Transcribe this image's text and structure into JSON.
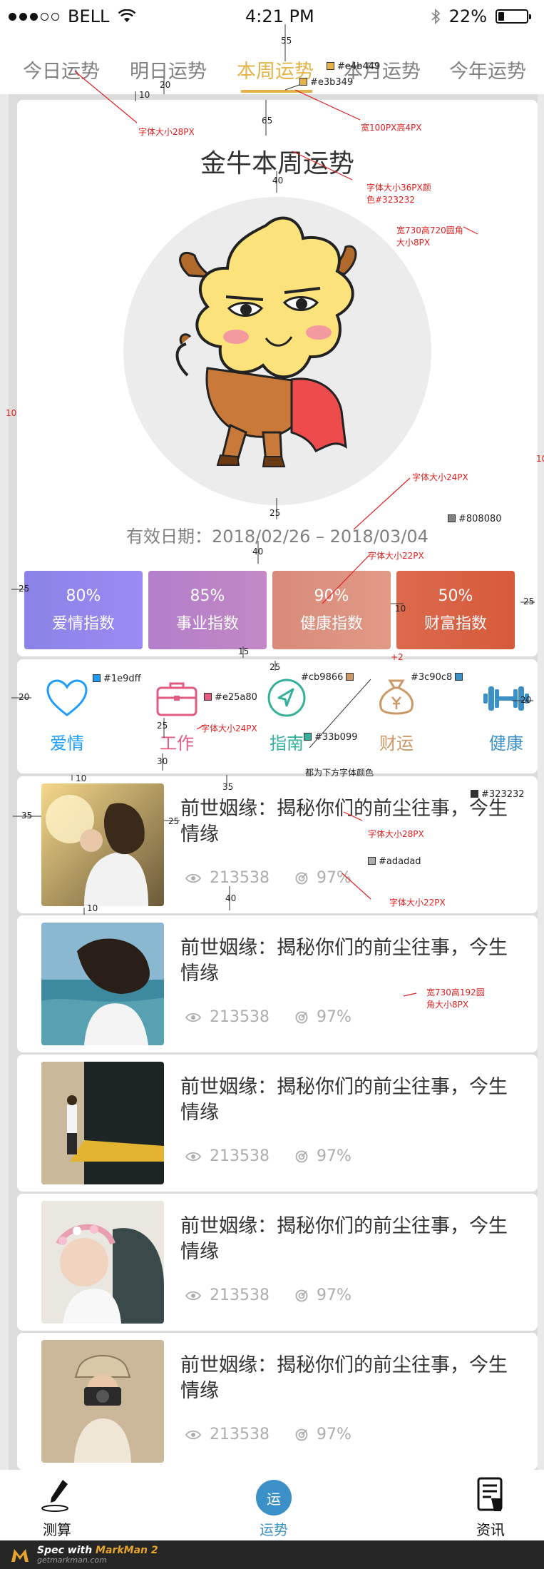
{
  "status_bar": {
    "carrier": "BELL",
    "time": "4:21 PM",
    "battery": "22%",
    "battery_level": 0.22
  },
  "tabs": [
    {
      "label": "今日运势"
    },
    {
      "label": "明日运势"
    },
    {
      "label": "本周运势",
      "active": true
    },
    {
      "label": "本月运势"
    },
    {
      "label": "今年运势"
    }
  ],
  "fortune": {
    "title": "金牛本周运势",
    "validity": "有效日期：2018/02/26 – 2018/03/04",
    "indices": [
      {
        "value": "80%",
        "label": "爱情指数"
      },
      {
        "value": "85%",
        "label": "事业指数"
      },
      {
        "value": "90%",
        "label": "健康指数"
      },
      {
        "value": "50%",
        "label": "财富指数"
      }
    ]
  },
  "categories": [
    {
      "label": "爱情",
      "icon": "heart-icon",
      "color": "#1e9dff"
    },
    {
      "label": "工作",
      "icon": "briefcase-icon",
      "color": "#e25a80"
    },
    {
      "label": "指南",
      "icon": "compass-icon",
      "color": "#33b099"
    },
    {
      "label": "财运",
      "icon": "money-bag-icon",
      "color": "#cb9866"
    },
    {
      "label": "健康",
      "icon": "dumbbell-icon",
      "color": "#3c90c8"
    }
  ],
  "articles": [
    {
      "title": "前世姻缘：揭秘你们的前尘往事，今生情缘",
      "views": "213538",
      "rate": "97%"
    },
    {
      "title": "前世姻缘：揭秘你们的前尘往事，今生情缘",
      "views": "213538",
      "rate": "97%"
    },
    {
      "title": "前世姻缘：揭秘你们的前尘往事，今生情缘",
      "views": "213538",
      "rate": "97%"
    },
    {
      "title": "前世姻缘：揭秘你们的前尘往事，今生情缘",
      "views": "213538",
      "rate": "97%"
    },
    {
      "title": "前世姻缘：揭秘你们的前尘往事，今生情缘",
      "views": "213538",
      "rate": "97%"
    }
  ],
  "bottom_nav": {
    "items": [
      {
        "label": "测算",
        "icon": "pen-icon"
      },
      {
        "label": "运势",
        "icon_text": "运",
        "active": true
      },
      {
        "label": "资讯",
        "icon": "news-icon"
      }
    ]
  },
  "branding": {
    "prefix": "Spec with ",
    "product": "MarkMan 2",
    "url": "getmarkman.com"
  },
  "annotations": {
    "tab_font": "字体大小28PX",
    "underline_size": "宽100PX高4PX",
    "title_font": "字体大小36PX颜色#323232",
    "card_size": "宽730高720圆角大小8PX",
    "date_font": "字体大小24PX",
    "index_font": "字体大小22PX",
    "cat_font": "字体大小24PX",
    "cat_note": "都为下方字体颜色",
    "art_title_font": "字体大小28PX",
    "art_meta_font": "字体大小22PX",
    "art_card_size": "宽730高192圆角大小8PX",
    "colors": {
      "tab_active": "#e4b449",
      "underline": "#e3b349",
      "date": "#808080",
      "art_title": "#323232",
      "art_meta": "#adadad",
      "love": "#1e9dff",
      "work": "#e25a80",
      "guide": "#33b099",
      "wealth": "#cb9866",
      "health": "#3c90c8"
    },
    "dims": [
      "55",
      "20",
      "10",
      "65",
      "40",
      "25",
      "40",
      "25",
      "25",
      "10",
      "15",
      "25",
      "+2",
      "20",
      "20",
      "25",
      "30",
      "35",
      "10",
      "35",
      "25",
      "40",
      "10",
      "10",
      "10"
    ]
  }
}
